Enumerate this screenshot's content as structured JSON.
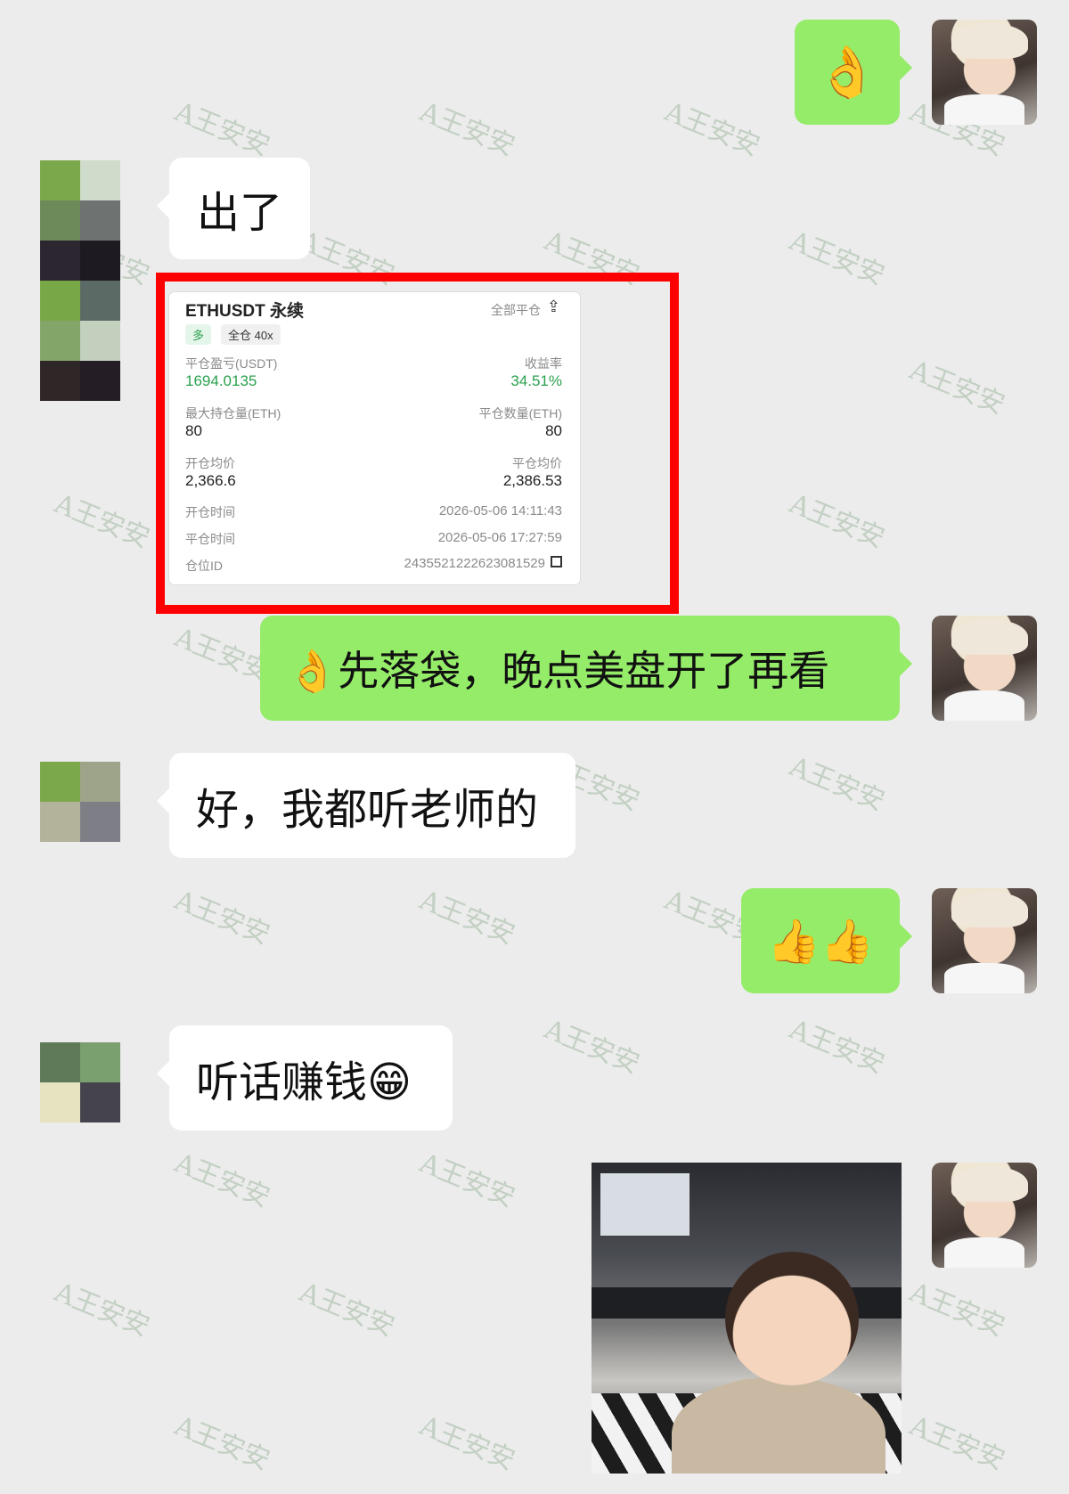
{
  "watermark": "A王安安",
  "messages": {
    "m1_emoji": "👌",
    "m2_text": "出了",
    "m4_text": "👌先落袋，晚点美盘开了再看",
    "m5_text": "好，我都听老师的",
    "m6_emoji": "👍👍",
    "m7_text": "听话赚钱😁"
  },
  "card": {
    "title": "ETHUSDT 永续",
    "close_all": "全部平仓",
    "share_icon": "share-icon",
    "side_tag": "多",
    "margin_tag": "全仓 40x",
    "pnl_label": "平仓盈亏(USDT)",
    "pnl_value": "1694.0135",
    "roi_label": "收益率",
    "roi_value": "34.51%",
    "max_pos_label": "最大持仓量(ETH)",
    "max_pos_value": "80",
    "close_qty_label": "平仓数量(ETH)",
    "close_qty_value": "80",
    "open_avg_label": "开仓均价",
    "open_avg_value": "2,366.6",
    "close_avg_label": "平仓均价",
    "close_avg_value": "2,386.53",
    "open_time_label": "开仓时间",
    "open_time_value": "2026-05-06 14:11:43",
    "close_time_label": "平仓时间",
    "close_time_value": "2026-05-06 17:27:59",
    "pos_id_label": "仓位ID",
    "pos_id_value": "243552122262308152​9"
  },
  "colors": {
    "bubble_out": "#95ec69",
    "bubble_in": "#ffffff",
    "background": "#ececec",
    "highlight_frame": "#ff0000",
    "profit_green": "#2ba14e"
  }
}
